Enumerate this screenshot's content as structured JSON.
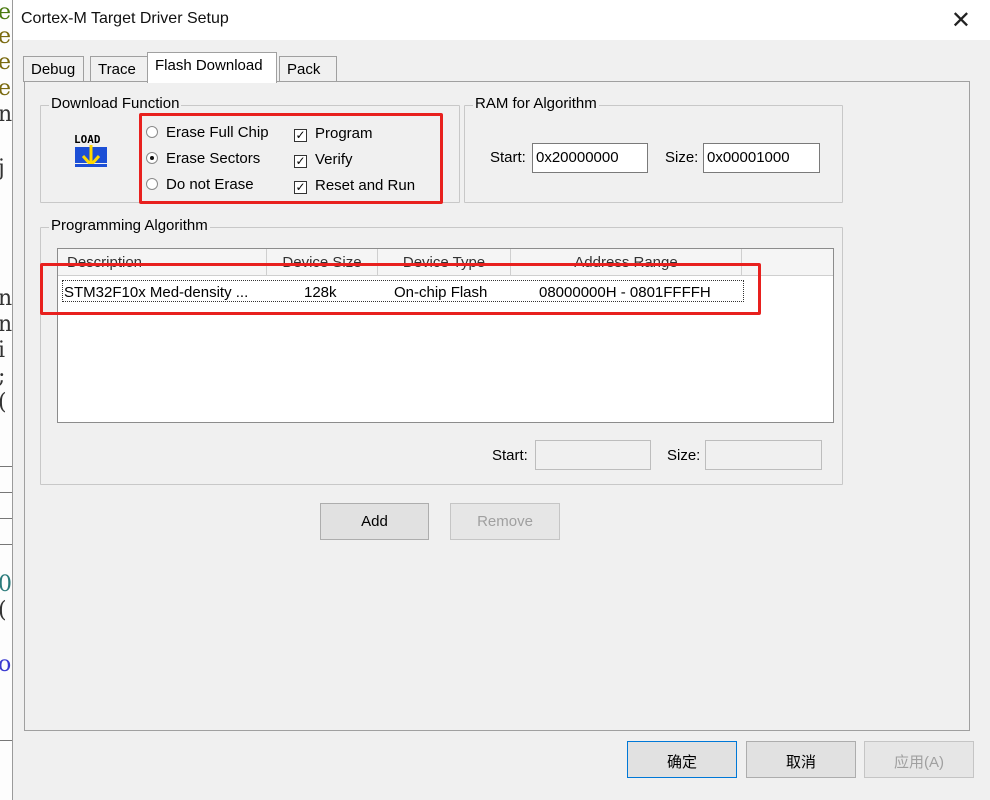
{
  "background_editor": {
    "glyphs": [
      "e",
      "e",
      "e",
      "e",
      "n",
      "j",
      "n",
      "n",
      "i",
      ";",
      "(",
      "0",
      "(",
      "o"
    ]
  },
  "window": {
    "title": "Cortex-M Target Driver Setup",
    "close_glyph": "✕"
  },
  "tabs": [
    {
      "label": "Debug"
    },
    {
      "label": "Trace"
    },
    {
      "label": "Flash Download"
    },
    {
      "label": "Pack"
    }
  ],
  "download_function": {
    "legend": "Download Function",
    "icon_text": "LOAD",
    "radios": [
      {
        "label": "Erase Full Chip",
        "selected": false
      },
      {
        "label": "Erase Sectors",
        "selected": true
      },
      {
        "label": "Do not Erase",
        "selected": false
      }
    ],
    "checks": [
      {
        "label": "Program",
        "checked": true
      },
      {
        "label": "Verify",
        "checked": true
      },
      {
        "label": "Reset and Run",
        "checked": true
      }
    ]
  },
  "ram_for_algorithm": {
    "legend": "RAM for Algorithm",
    "start_label": "Start:",
    "start_value": "0x20000000",
    "size_label": "Size:",
    "size_value": "0x00001000"
  },
  "programming_algorithm": {
    "legend": "Programming Algorithm",
    "columns": [
      "Description",
      "Device Size",
      "Device Type",
      "Address Range"
    ],
    "rows": [
      {
        "description": "STM32F10x Med-density ...",
        "device_size": "128k",
        "device_type": "On-chip Flash",
        "address_range": "08000000H - 0801FFFFH"
      }
    ],
    "start_label": "Start:",
    "start_value": "",
    "size_label": "Size:",
    "size_value": ""
  },
  "buttons": {
    "add": "Add",
    "remove": "Remove",
    "ok": "确定",
    "cancel": "取消",
    "apply": "应用(A)"
  },
  "colors": {
    "highlight_box": "#e8201e",
    "icon_blue": "#1c4fd6",
    "icon_yellow": "#ffd800"
  }
}
